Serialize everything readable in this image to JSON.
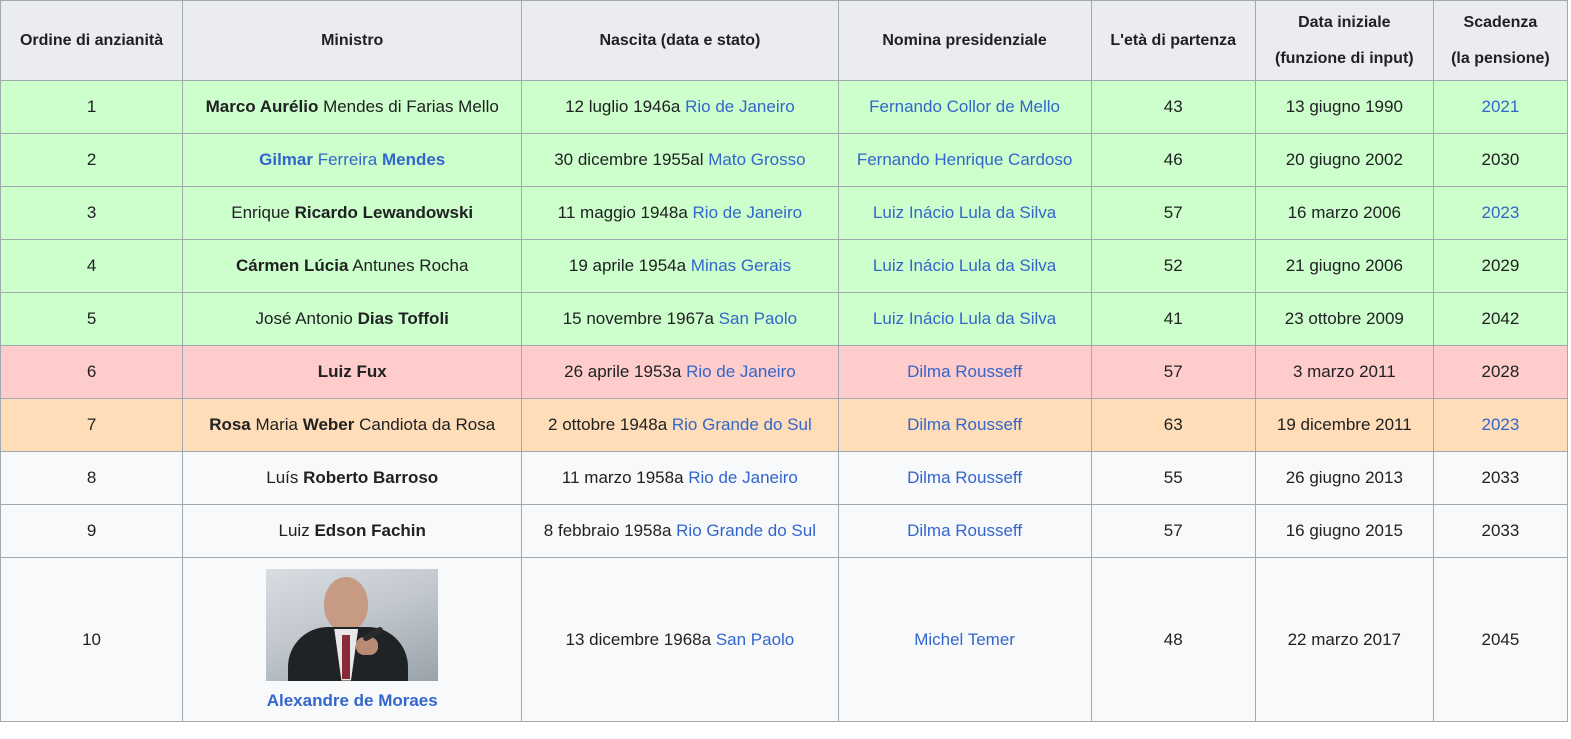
{
  "headers": [
    {
      "line1": "Ordine di anzianità",
      "line2": ""
    },
    {
      "line1": "Ministro",
      "line2": ""
    },
    {
      "line1": "Nascita (data e stato)",
      "line2": ""
    },
    {
      "line1": "Nomina presidenziale",
      "line2": ""
    },
    {
      "line1": "L'età di partenza",
      "line2": ""
    },
    {
      "line1": "Data iniziale",
      "line2": "(funzione di input)"
    },
    {
      "line1": "Scadenza",
      "line2": "(la pensione)"
    }
  ],
  "colors": {
    "green": "#ccffcc",
    "red": "#ffcccc",
    "orange": "#ffddb8",
    "plain": "#f8f9fa",
    "link": "#3366cc",
    "border": "#a2a9b1",
    "header": "#eaecf0"
  },
  "rows": [
    {
      "order": "1",
      "name": [
        {
          "t": "Marco Aurélio",
          "s": "b"
        },
        {
          "t": " Mendes di Farias Mello",
          "s": ""
        }
      ],
      "birth_date": "12 luglio 1946a ",
      "birth_state": "Rio de Janeiro",
      "president": "Fernando Collor de Mello",
      "age": "43",
      "start": "13 giugno 1990",
      "expiry": "2021",
      "expiry_link": true,
      "color": "green"
    },
    {
      "order": "2",
      "name": [
        {
          "t": "Gilmar",
          "s": "bl"
        },
        {
          "t": " Ferreira ",
          "s": "l"
        },
        {
          "t": "Mendes",
          "s": "bl"
        }
      ],
      "birth_date": "30 dicembre 1955al ",
      "birth_state": "Mato Grosso",
      "president": "Fernando Henrique Cardoso",
      "age": "46",
      "start": "20 giugno 2002",
      "expiry": "2030",
      "expiry_link": false,
      "color": "green"
    },
    {
      "order": "3",
      "name": [
        {
          "t": "Enrique ",
          "s": ""
        },
        {
          "t": "Ricardo Lewandowski",
          "s": "b"
        }
      ],
      "birth_date": "11 maggio 1948a ",
      "birth_state": "Rio de Janeiro",
      "president": "Luiz Inácio Lula da Silva",
      "age": "57",
      "start": "16 marzo 2006",
      "expiry": "2023",
      "expiry_link": true,
      "color": "green"
    },
    {
      "order": "4",
      "name": [
        {
          "t": "Cármen Lúcia",
          "s": "b"
        },
        {
          "t": " Antunes Rocha",
          "s": ""
        }
      ],
      "birth_date": "19 aprile 1954a ",
      "birth_state": "Minas Gerais",
      "president": "Luiz Inácio Lula da Silva",
      "age": "52",
      "start": "21 giugno 2006",
      "expiry": "2029",
      "expiry_link": false,
      "color": "green"
    },
    {
      "order": "5",
      "name": [
        {
          "t": "José Antonio ",
          "s": ""
        },
        {
          "t": "Dias Toffoli",
          "s": "b"
        }
      ],
      "birth_date": "15 novembre 1967a ",
      "birth_state": "San Paolo",
      "president": "Luiz Inácio Lula da Silva",
      "age": "41",
      "start": "23 ottobre 2009",
      "expiry": "2042",
      "expiry_link": false,
      "color": "green"
    },
    {
      "order": "6",
      "name": [
        {
          "t": "Luiz Fux",
          "s": "b"
        }
      ],
      "birth_date": "26 aprile 1953a ",
      "birth_state": "Rio de Janeiro",
      "president": "Dilma Rousseff",
      "age": "57",
      "start": "3 marzo 2011",
      "expiry": "2028",
      "expiry_link": false,
      "color": "red"
    },
    {
      "order": "7",
      "name": [
        {
          "t": "Rosa",
          "s": "b"
        },
        {
          "t": " Maria ",
          "s": ""
        },
        {
          "t": "Weber",
          "s": "b"
        },
        {
          "t": " Candiota da Rosa",
          "s": ""
        }
      ],
      "birth_date": "2 ottobre 1948a ",
      "birth_state": "Rio Grande do Sul",
      "president": "Dilma Rousseff",
      "age": "63",
      "start": "19 dicembre 2011",
      "expiry": "2023",
      "expiry_link": true,
      "color": "orange"
    },
    {
      "order": "8",
      "name": [
        {
          "t": "Luís ",
          "s": ""
        },
        {
          "t": "Roberto Barroso",
          "s": "b"
        }
      ],
      "birth_date": "11 marzo 1958a ",
      "birth_state": "Rio de Janeiro",
      "president": "Dilma Rousseff",
      "age": "55",
      "start": "26 giugno 2013",
      "expiry": "2033",
      "expiry_link": false,
      "color": "plain"
    },
    {
      "order": "9",
      "name": [
        {
          "t": "Luiz ",
          "s": ""
        },
        {
          "t": "Edson Fachin",
          "s": "b"
        }
      ],
      "birth_date": "8 febbraio 1958a ",
      "birth_state": "Rio Grande do Sul",
      "president": "Dilma Rousseff",
      "age": "57",
      "start": "16 giugno 2015",
      "expiry": "2033",
      "expiry_link": false,
      "color": "plain"
    },
    {
      "order": "10",
      "name": [
        {
          "t": "Alexandre de Moraes",
          "s": "bl"
        }
      ],
      "photo": "portrait-photo",
      "birth_date": "13 dicembre 1968a ",
      "birth_state": "San Paolo",
      "president": "Michel Temer",
      "age": "48",
      "start": "22 marzo 2017",
      "expiry": "2045",
      "expiry_link": false,
      "color": "plain"
    }
  ]
}
